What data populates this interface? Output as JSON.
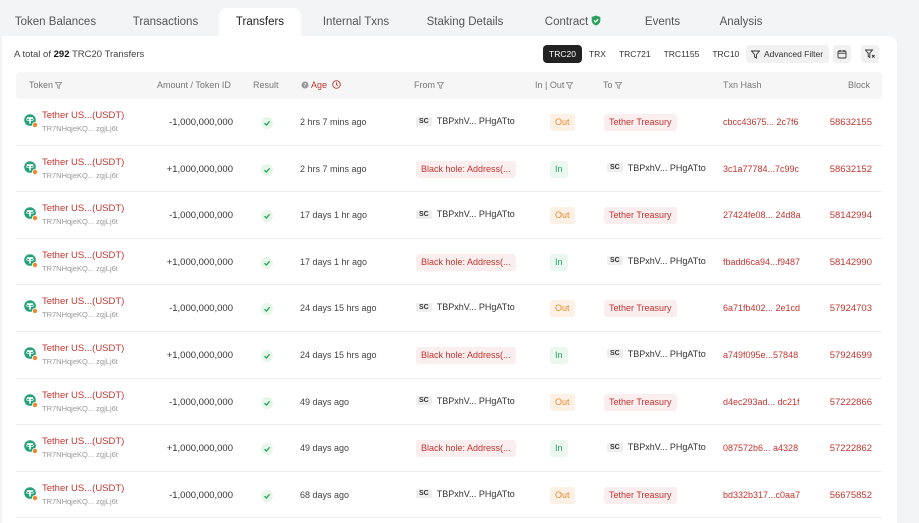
{
  "tabs": [
    {
      "label": "Token Balances"
    },
    {
      "label": "Transactions"
    },
    {
      "label": "Transfers"
    },
    {
      "label": "Internal Txns"
    },
    {
      "label": "Staking Details"
    },
    {
      "label": "Contract"
    },
    {
      "label": "Events"
    },
    {
      "label": "Analysis"
    }
  ],
  "summary": {
    "prefix": "A total of",
    "count": "292",
    "suffix": "TRC20 Transfers"
  },
  "filters": [
    "TRC20",
    "TRX",
    "TRC721",
    "TRC1155",
    "TRC10"
  ],
  "advanced_filter": "Advanced Filter",
  "columns": {
    "token": "Token",
    "amount": "Amount / Token ID",
    "result": "Result",
    "age": "Age",
    "from": "From",
    "inout": "In | Out",
    "to": "To",
    "hash": "Txn Hash",
    "block": "Block"
  },
  "colors": {
    "accent": "#c23631",
    "out": "#e88a2f",
    "in": "#2aa360",
    "tether": "#26a17b"
  },
  "rows": [
    {
      "token": "Tether US...(USDT)",
      "token_addr": "TR7NHqjeKQ... zgjLj6t",
      "amount": "-1,000,000,000",
      "age": "2 hrs 7 mins ago",
      "from_sc": "SC",
      "from": "TBPxhV... PHgATto",
      "dir": "Out",
      "to": "Tether Treasury",
      "hash": "cbcc43675... 2c7f6",
      "block": "58632155"
    },
    {
      "token": "Tether US...(USDT)",
      "token_addr": "TR7NHqjeKQ... zgjLj6t",
      "amount": "+1,000,000,000",
      "age": "2 hrs 7 mins ago",
      "from": "Black hole: Address(...",
      "dir": "In",
      "to_sc": "SC",
      "to": "TBPxhV... PHgATto",
      "hash": "3c1a77784...7c99c",
      "block": "58632152"
    },
    {
      "token": "Tether US...(USDT)",
      "token_addr": "TR7NHqjeKQ... zgjLj6t",
      "amount": "-1,000,000,000",
      "age": "17 days 1 hr ago",
      "from_sc": "SC",
      "from": "TBPxhV... PHgATto",
      "dir": "Out",
      "to": "Tether Treasury",
      "hash": "27424fe08... 24d8a",
      "block": "58142994"
    },
    {
      "token": "Tether US...(USDT)",
      "token_addr": "TR7NHqjeKQ... zgjLj6t",
      "amount": "+1,000,000,000",
      "age": "17 days 1 hr ago",
      "from": "Black hole: Address(...",
      "dir": "In",
      "to_sc": "SC",
      "to": "TBPxhV... PHgATto",
      "hash": "fbadd6ca94...f9487",
      "block": "58142990"
    },
    {
      "token": "Tether US...(USDT)",
      "token_addr": "TR7NHqjeKQ... zgjLj6t",
      "amount": "-1,000,000,000",
      "age": "24 days 15 hrs ago",
      "from_sc": "SC",
      "from": "TBPxhV... PHgATto",
      "dir": "Out",
      "to": "Tether Treasury",
      "hash": "6a71fb402... 2e1cd",
      "block": "57924703"
    },
    {
      "token": "Tether US...(USDT)",
      "token_addr": "TR7NHqjeKQ... zgjLj6t",
      "amount": "+1,000,000,000",
      "age": "24 days 15 hrs ago",
      "from": "Black hole: Address(...",
      "dir": "In",
      "to_sc": "SC",
      "to": "TBPxhV... PHgATto",
      "hash": "a749f095e...57848",
      "block": "57924699"
    },
    {
      "token": "Tether US...(USDT)",
      "token_addr": "TR7NHqjeKQ... zgjLj6t",
      "amount": "-1,000,000,000",
      "age": "49 days ago",
      "from_sc": "SC",
      "from": "TBPxhV... PHgATto",
      "dir": "Out",
      "to": "Tether Treasury",
      "hash": "d4ec293ad... dc21f",
      "block": "57222866"
    },
    {
      "token": "Tether US...(USDT)",
      "token_addr": "TR7NHqjeKQ... zgjLj6t",
      "amount": "+1,000,000,000",
      "age": "49 days ago",
      "from": "Black hole: Address(...",
      "dir": "In",
      "to_sc": "SC",
      "to": "TBPxhV... PHgATto",
      "hash": "087572b6... a4328",
      "block": "57222862"
    },
    {
      "token": "Tether US...(USDT)",
      "token_addr": "TR7NHqjeKQ... zgjLj6t",
      "amount": "-1,000,000,000",
      "age": "68 days ago",
      "from_sc": "SC",
      "from": "TBPxhV... PHgATto",
      "dir": "Out",
      "to": "Tether Treasury",
      "hash": "bd332b317...c0aa7",
      "block": "56675852"
    }
  ]
}
